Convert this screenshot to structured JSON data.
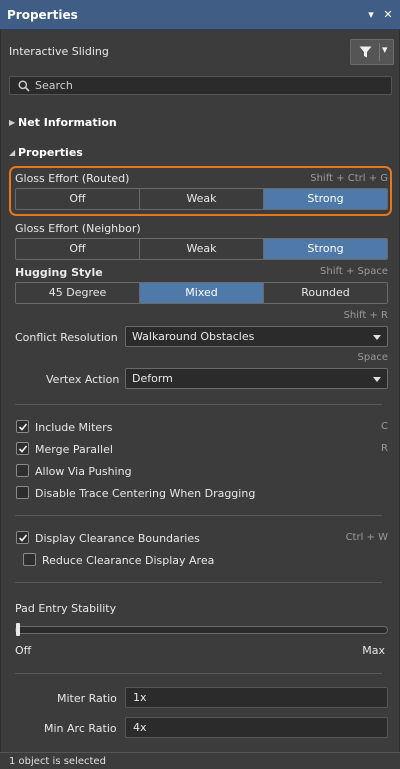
{
  "titlebar": {
    "title": "Properties",
    "pin_glyph": "▾",
    "close_glyph": "✕"
  },
  "header": {
    "mode_label": "Interactive Sliding",
    "filter_icon": "filter-icon",
    "dropdown_glyph": "▾"
  },
  "search": {
    "placeholder": "Search"
  },
  "sections": {
    "net_information": "Net Information",
    "properties": "Properties"
  },
  "gloss_routed": {
    "label": "Gloss Effort (Routed)",
    "shortcut": "Shift + Ctrl + G",
    "options": [
      "Off",
      "Weak",
      "Strong"
    ],
    "selected": "Strong"
  },
  "gloss_neighbor": {
    "label": "Gloss Effort (Neighbor)",
    "options": [
      "Off",
      "Weak",
      "Strong"
    ],
    "selected": "Strong"
  },
  "hugging": {
    "label": "Hugging Style",
    "shortcut": "Shift + Space",
    "options": [
      "45 Degree",
      "Mixed",
      "Rounded"
    ],
    "selected": "Mixed"
  },
  "conflict": {
    "shortcut": "Shift + R",
    "label": "Conflict Resolution",
    "value": "Walkaround Obstacles"
  },
  "vertex": {
    "shortcut": "Space",
    "label": "Vertex Action",
    "value": "Deform"
  },
  "checkboxes": {
    "include_miters": {
      "label": "Include Miters",
      "checked": true,
      "shortcut": "C"
    },
    "merge_parallel": {
      "label": "Merge Parallel",
      "checked": true,
      "shortcut": "R"
    },
    "allow_via_pushing": {
      "label": "Allow Via Pushing",
      "checked": false
    },
    "disable_trace_centering": {
      "label": "Disable Trace Centering When Dragging",
      "checked": false
    },
    "display_clearance": {
      "label": "Display Clearance Boundaries",
      "checked": true,
      "shortcut": "Ctrl + W"
    },
    "reduce_clearance": {
      "label": "Reduce Clearance Display Area",
      "checked": false
    }
  },
  "pad_entry": {
    "label": "Pad Entry Stability",
    "min_label": "Off",
    "max_label": "Max",
    "value_fraction": 0.0
  },
  "miter_ratio": {
    "label": "Miter Ratio",
    "value": "1x"
  },
  "min_arc_ratio": {
    "label": "Min Arc Ratio",
    "value": "4x"
  },
  "status": {
    "text": "1 object is selected"
  },
  "colors": {
    "accent": "#4f79a8",
    "highlight_outline": "#e8761b",
    "titlebar": "#3f5d85"
  }
}
